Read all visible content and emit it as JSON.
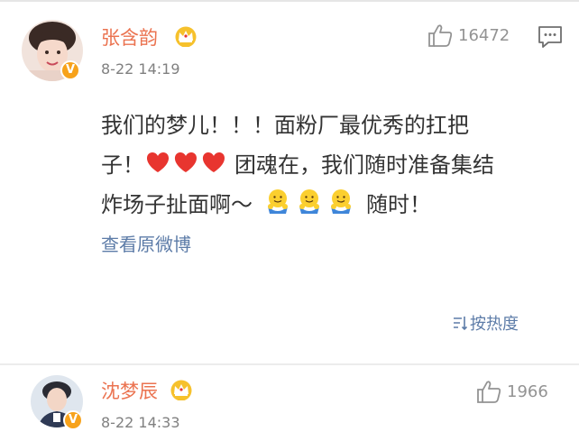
{
  "first_comment": {
    "username": "张含韵",
    "time": "8-22 14:19",
    "likes": "16472",
    "text_lines": [
      "我们的梦儿！！！面粉厂最优秀的扛把",
      "子！",
      "团魂在，我们随时准备集结",
      "炸场子扯面啊～",
      "随时！"
    ],
    "view_original": "查看原微博",
    "verified_badge": "V"
  },
  "sort": {
    "label": "按热度"
  },
  "second_comment": {
    "username": "沈梦辰",
    "time": "8-22 14:33",
    "likes": "1966",
    "verified_badge": "V"
  },
  "colors": {
    "username": "#eb7350",
    "link": "#5d7ca8",
    "meta": "#808080",
    "badge": "#f7a21b",
    "heart": "#e8352f"
  },
  "icons": [
    "crown-icon",
    "thumbs-up-icon",
    "comment-icon",
    "sort-icon",
    "heart-emoji",
    "hug-emoji"
  ]
}
